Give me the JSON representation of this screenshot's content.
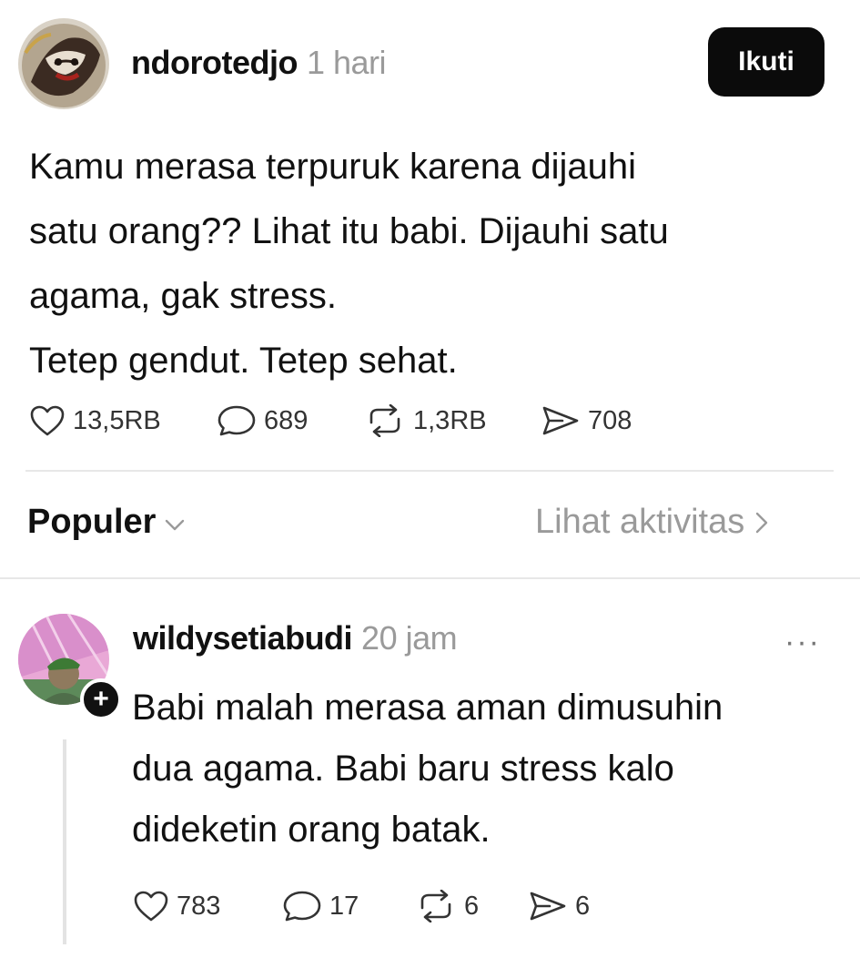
{
  "post": {
    "username": "ndorotedjo",
    "time": "1 hari",
    "follow_label": "Ikuti",
    "text": "Kamu merasa terpuruk karena dijauhi\nsatu orang?? Lihat itu babi. Dijauhi satu\nagama, gak stress.\nTetep gendut. Tetep sehat.",
    "stats": {
      "likes": "13,5RB",
      "comments": "689",
      "reposts": "1,3RB",
      "shares": "708"
    }
  },
  "replies_header": {
    "sort_label": "Populer",
    "activity_label": "Lihat aktivitas"
  },
  "reply": {
    "username": "wildysetiabudi",
    "time": "20 jam",
    "more_label": "···",
    "follow_badge": "+",
    "text": "Babi malah merasa aman dimusuhin\ndua agama. Babi baru stress kalo\ndideketin orang batak.",
    "stats": {
      "likes": "783",
      "comments": "17",
      "reposts": "6",
      "shares": "6"
    }
  },
  "icons": {
    "like": "heart-icon",
    "comment": "comment-icon",
    "repost": "repost-icon",
    "share": "share-icon",
    "sort": "chevron-down-icon",
    "activity": "chevron-right-icon"
  },
  "colors": {
    "follow_bg": "#0b0b0b",
    "muted_text": "#9a9a9a",
    "divider": "#e7e7e7"
  }
}
